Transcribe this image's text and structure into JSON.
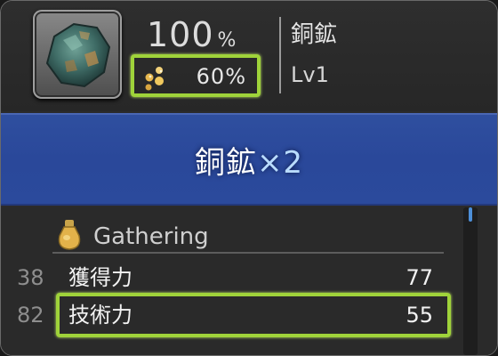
{
  "item": {
    "icon": "copper-ore-icon",
    "success_rate": "100",
    "success_unit": "%",
    "hq_icon": "hq-chance-icon",
    "hq_rate": "60%",
    "name": "銅鉱",
    "level": "Lv1"
  },
  "result": {
    "name": "銅鉱",
    "quantity": "×2"
  },
  "stats": {
    "section_icon": "gathering-pot-icon",
    "section_title": "Gathering",
    "rows": [
      {
        "lead": "38",
        "label": "獲得力",
        "value": "77"
      },
      {
        "lead": "82",
        "label": "技術力",
        "value": "55"
      }
    ]
  },
  "colors": {
    "highlight": "#9fd33a",
    "banner": "#2b4a9c",
    "panel": "#2b2b2b"
  }
}
